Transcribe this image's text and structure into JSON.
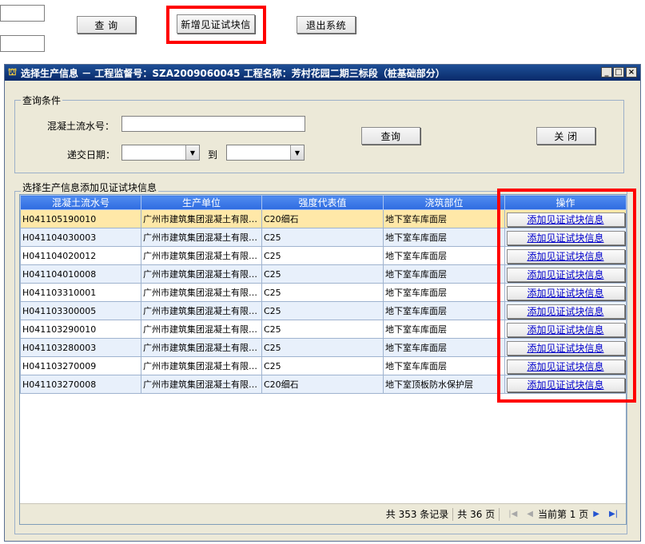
{
  "toolbar": {
    "query_label": "查  询",
    "add_witness_label": "新增见证试块信",
    "exit_label": "退出系统"
  },
  "dialog": {
    "title": "选择生产信息  － 工程监督号：SZA2009060045   工程名称：芳村花园二期三标段（桩基础部分）",
    "controls": {
      "minimize": "_",
      "maximize": "□",
      "close": "×"
    }
  },
  "query": {
    "group_title": "查询条件",
    "serial_label": "混凝土流水号：",
    "serial_value": "",
    "date_label": "递交日期：",
    "to_label": "到",
    "date_from": "",
    "date_to": "",
    "query_button": "查询",
    "close_button": "关  闭"
  },
  "results": {
    "group_title": "选择生产信息添加见证试块信息",
    "columns": [
      "混凝土流水号",
      "生产单位",
      "强度代表值",
      "浇筑部位",
      "操作"
    ],
    "rows": [
      {
        "serial": "H041105190010",
        "unit": "广州市建筑集团混凝土有限公司",
        "strength": "C20细石",
        "location": "地下室车库面层",
        "action": "添加见证试块信息"
      },
      {
        "serial": "H041104030003",
        "unit": "广州市建筑集团混凝土有限公司",
        "strength": "C25",
        "location": "地下室车库面层",
        "action": "添加见证试块信息"
      },
      {
        "serial": "H041104020012",
        "unit": "广州市建筑集团混凝土有限公司",
        "strength": "C25",
        "location": "地下室车库面层",
        "action": "添加见证试块信息"
      },
      {
        "serial": "H041104010008",
        "unit": "广州市建筑集团混凝土有限公司",
        "strength": "C25",
        "location": "地下室车库面层",
        "action": "添加见证试块信息"
      },
      {
        "serial": "H041103310001",
        "unit": "广州市建筑集团混凝土有限公司",
        "strength": "C25",
        "location": "地下室车库面层",
        "action": "添加见证试块信息"
      },
      {
        "serial": "H041103300005",
        "unit": "广州市建筑集团混凝土有限公司",
        "strength": "C25",
        "location": "地下室车库面层",
        "action": "添加见证试块信息"
      },
      {
        "serial": "H041103290010",
        "unit": "广州市建筑集团混凝土有限公司",
        "strength": "C25",
        "location": "地下室车库面层",
        "action": "添加见证试块信息"
      },
      {
        "serial": "H041103280003",
        "unit": "广州市建筑集团混凝土有限公司",
        "strength": "C25",
        "location": "地下室车库面层",
        "action": "添加见证试块信息"
      },
      {
        "serial": "H041103270009",
        "unit": "广州市建筑集团混凝土有限公司",
        "strength": "C25",
        "location": "地下室车库面层",
        "action": "添加见证试块信息"
      },
      {
        "serial": "H041103270008",
        "unit": "广州市建筑集团混凝土有限公司",
        "strength": "C20细石",
        "location": "地下室顶板防水保护层",
        "action": "添加见证试块信息"
      }
    ],
    "selected_row": 0
  },
  "pager": {
    "total_records": "共 353 条记录",
    "total_pages": "共 36 页",
    "current_page": "当前第 1 页"
  },
  "colors": {
    "title_bar": "#0a2a6a",
    "header_bg": "#3a78e8",
    "selected_row": "#ffe8a8",
    "alt_row": "#e8f0fb",
    "highlight_box": "#ff0000",
    "window_bg": "#ece9d8"
  },
  "icons": {
    "app": "construction-icon",
    "pager_first": "first-page-icon",
    "pager_prev": "prev-page-icon",
    "pager_next": "next-page-icon",
    "pager_last": "last-page-icon"
  }
}
